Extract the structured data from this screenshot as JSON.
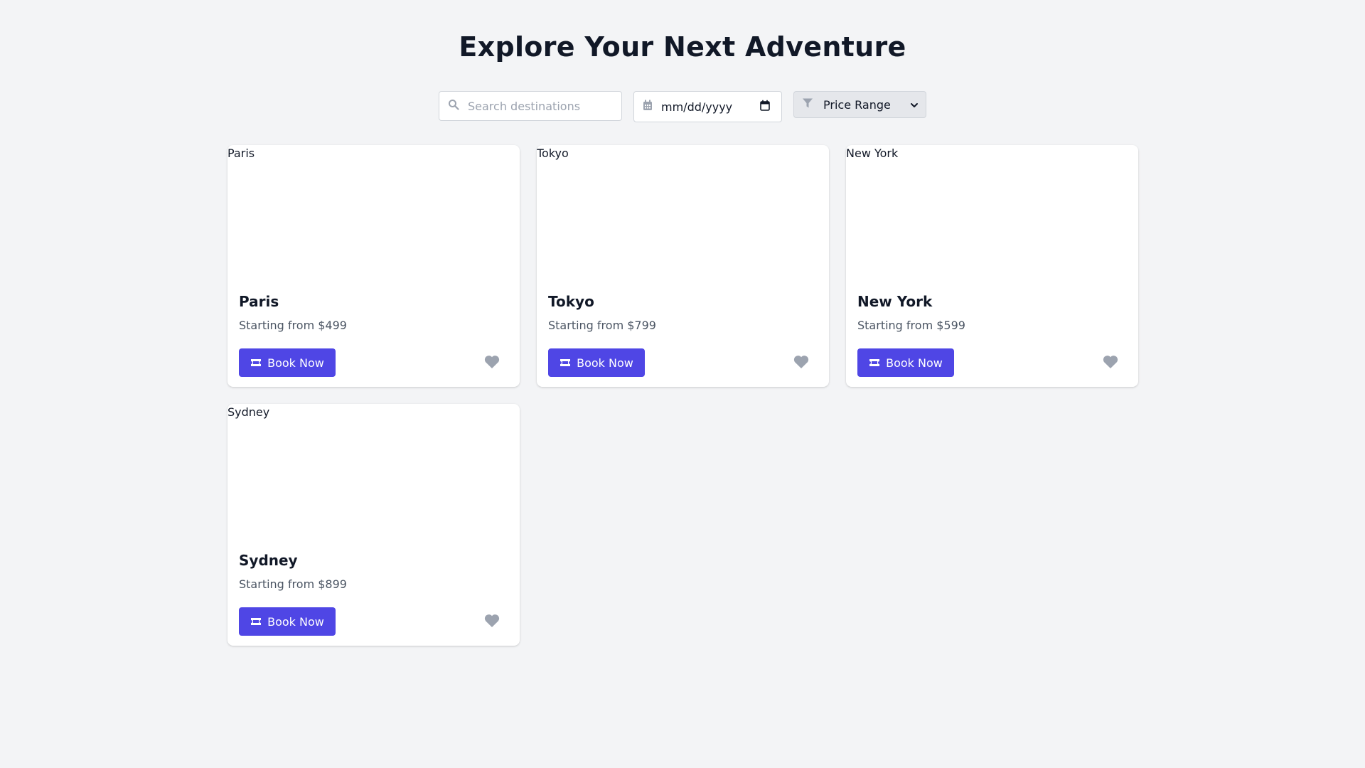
{
  "header": {
    "title": "Explore Your Next Adventure"
  },
  "filters": {
    "search": {
      "placeholder": "Search destinations",
      "icon": "search-icon"
    },
    "date": {
      "value": "mm/dd/yyyy",
      "icon": "calendar-icon"
    },
    "price": {
      "selected": "Price Range",
      "icon": "filter-icon"
    }
  },
  "destinations": [
    {
      "name": "Paris",
      "image_alt": "Paris",
      "price": "Starting from $499",
      "button": "Book Now"
    },
    {
      "name": "Tokyo",
      "image_alt": "Tokyo",
      "price": "Starting from $799",
      "button": "Book Now"
    },
    {
      "name": "New York",
      "image_alt": "New York",
      "price": "Starting from $599",
      "button": "Book Now"
    },
    {
      "name": "Sydney",
      "image_alt": "Sydney",
      "price": "Starting from $899",
      "button": "Book Now"
    }
  ],
  "colors": {
    "accent": "#4f46e5",
    "background": "#f3f4f6",
    "heart": "#9ca3af"
  }
}
